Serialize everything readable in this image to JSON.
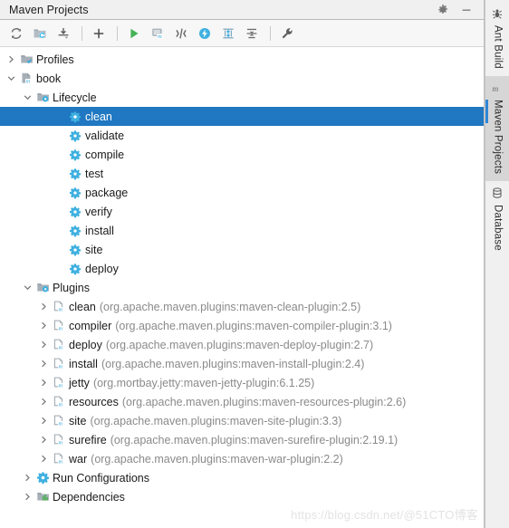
{
  "window": {
    "title": "Maven Projects",
    "actions": [
      {
        "name": "settings-icon",
        "label": "Settings"
      },
      {
        "name": "minimize-icon",
        "label": "Hide"
      }
    ]
  },
  "toolbar": {
    "buttons": [
      {
        "name": "reload-projects-button",
        "icon": "refresh-icon",
        "tooltip": "Reimport All Maven Projects"
      },
      {
        "name": "generate-sources-button",
        "icon": "folder-refresh-icon",
        "tooltip": "Generate Sources and Update Folders"
      },
      {
        "name": "download-sources-button",
        "icon": "download-icon",
        "tooltip": "Download Sources and/or Documentation"
      },
      {
        "name": "add-maven-project-button",
        "icon": "plus-icon",
        "tooltip": "Add Maven Projects"
      },
      {
        "name": "run-build-button",
        "icon": "run-icon",
        "tooltip": "Run Maven Build"
      },
      {
        "name": "execute-goal-button",
        "icon": "maven-goal-icon",
        "tooltip": "Execute Maven Goal"
      },
      {
        "name": "toggle-skip-tests-button",
        "icon": "skip-tests-icon",
        "tooltip": "Toggle Skip Tests Mode"
      },
      {
        "name": "toggle-offline-button",
        "icon": "offline-icon",
        "tooltip": "Toggle Offline Mode"
      },
      {
        "name": "expand-all-button",
        "icon": "expand-all-icon",
        "tooltip": "Expand All"
      },
      {
        "name": "collapse-all-button",
        "icon": "collapse-all-icon",
        "tooltip": "Collapse All"
      },
      {
        "name": "maven-settings-button",
        "icon": "wrench-icon",
        "tooltip": "Maven Settings"
      }
    ]
  },
  "colors": {
    "selection": "#1f78c1",
    "accent_icon": "#3fb0e0",
    "folder": "#9aa7b0",
    "run_green": "#4caf50",
    "watermark": "#e3e3e3"
  },
  "tree": {
    "rows": [
      {
        "label": "Profiles",
        "indent": 0,
        "arrow": "collapsed",
        "icon": "profiles-folder-icon",
        "selected": false,
        "coord": ""
      },
      {
        "label": "book",
        "indent": 0,
        "arrow": "expanded",
        "icon": "maven-module-icon",
        "selected": false,
        "coord": ""
      },
      {
        "label": "Lifecycle",
        "indent": 1,
        "arrow": "expanded",
        "icon": "lifecycle-folder-icon",
        "selected": false,
        "coord": ""
      },
      {
        "label": "clean",
        "indent": 3,
        "arrow": "none",
        "icon": "goal-gear-icon",
        "selected": true,
        "coord": ""
      },
      {
        "label": "validate",
        "indent": 3,
        "arrow": "none",
        "icon": "goal-gear-icon",
        "selected": false,
        "coord": ""
      },
      {
        "label": "compile",
        "indent": 3,
        "arrow": "none",
        "icon": "goal-gear-icon",
        "selected": false,
        "coord": ""
      },
      {
        "label": "test",
        "indent": 3,
        "arrow": "none",
        "icon": "goal-gear-icon",
        "selected": false,
        "coord": ""
      },
      {
        "label": "package",
        "indent": 3,
        "arrow": "none",
        "icon": "goal-gear-icon",
        "selected": false,
        "coord": ""
      },
      {
        "label": "verify",
        "indent": 3,
        "arrow": "none",
        "icon": "goal-gear-icon",
        "selected": false,
        "coord": ""
      },
      {
        "label": "install",
        "indent": 3,
        "arrow": "none",
        "icon": "goal-gear-icon",
        "selected": false,
        "coord": ""
      },
      {
        "label": "site",
        "indent": 3,
        "arrow": "none",
        "icon": "goal-gear-icon",
        "selected": false,
        "coord": ""
      },
      {
        "label": "deploy",
        "indent": 3,
        "arrow": "none",
        "icon": "goal-gear-icon",
        "selected": false,
        "coord": ""
      },
      {
        "label": "Plugins",
        "indent": 1,
        "arrow": "expanded",
        "icon": "plugins-folder-icon",
        "selected": false,
        "coord": ""
      },
      {
        "label": "clean",
        "indent": 2,
        "arrow": "collapsed",
        "icon": "plugin-icon",
        "selected": false,
        "coord": "(org.apache.maven.plugins:maven-clean-plugin:2.5)"
      },
      {
        "label": "compiler",
        "indent": 2,
        "arrow": "collapsed",
        "icon": "plugin-icon",
        "selected": false,
        "coord": "(org.apache.maven.plugins:maven-compiler-plugin:3.1)"
      },
      {
        "label": "deploy",
        "indent": 2,
        "arrow": "collapsed",
        "icon": "plugin-icon",
        "selected": false,
        "coord": "(org.apache.maven.plugins:maven-deploy-plugin:2.7)"
      },
      {
        "label": "install",
        "indent": 2,
        "arrow": "collapsed",
        "icon": "plugin-icon",
        "selected": false,
        "coord": "(org.apache.maven.plugins:maven-install-plugin:2.4)"
      },
      {
        "label": "jetty",
        "indent": 2,
        "arrow": "collapsed",
        "icon": "plugin-icon",
        "selected": false,
        "coord": "(org.mortbay.jetty:maven-jetty-plugin:6.1.25)"
      },
      {
        "label": "resources",
        "indent": 2,
        "arrow": "collapsed",
        "icon": "plugin-icon",
        "selected": false,
        "coord": "(org.apache.maven.plugins:maven-resources-plugin:2.6)"
      },
      {
        "label": "site",
        "indent": 2,
        "arrow": "collapsed",
        "icon": "plugin-icon",
        "selected": false,
        "coord": "(org.apache.maven.plugins:maven-site-plugin:3.3)"
      },
      {
        "label": "surefire",
        "indent": 2,
        "arrow": "collapsed",
        "icon": "plugin-icon",
        "selected": false,
        "coord": "(org.apache.maven.plugins:maven-surefire-plugin:2.19.1)"
      },
      {
        "label": "war",
        "indent": 2,
        "arrow": "collapsed",
        "icon": "plugin-icon",
        "selected": false,
        "coord": "(org.apache.maven.plugins:maven-war-plugin:2.2)"
      },
      {
        "label": "Run Configurations",
        "indent": 1,
        "arrow": "collapsed",
        "icon": "run-config-gear-icon",
        "selected": false,
        "coord": ""
      },
      {
        "label": "Dependencies",
        "indent": 1,
        "arrow": "collapsed",
        "icon": "dependencies-icon",
        "selected": false,
        "coord": ""
      }
    ]
  },
  "tabstrip": {
    "tabs": [
      {
        "label": "Ant Build",
        "icon": "ant-icon",
        "active": false
      },
      {
        "label": "Maven Projects",
        "icon": "maven-m-icon",
        "active": true
      },
      {
        "label": "Database",
        "icon": "database-icon",
        "active": false
      }
    ]
  },
  "watermark": {
    "text": "https://blog.csdn.net/@51CTO博客"
  }
}
